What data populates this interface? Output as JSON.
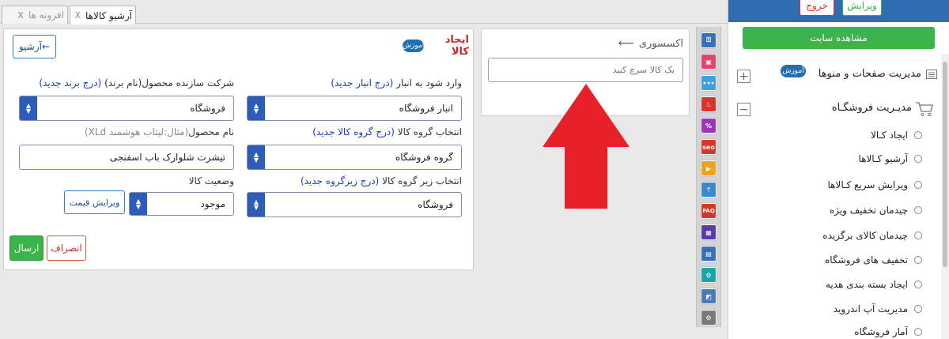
{
  "tabs": [
    {
      "label": "آرشیو کالاها",
      "close": "X",
      "active": true
    },
    {
      "label": "افزونه ها",
      "close": "X",
      "active": false
    }
  ],
  "form": {
    "title": "ایجاد کالا",
    "tutorial_badge": "آموزش",
    "archive_button": "آرشیو←",
    "warehouse_label": "وارد شود به انبار",
    "warehouse_link": "(درج انبار جدید)",
    "warehouse_value": "انبار فروشگاه",
    "manufacturer_label": "شرکت سازنده محصول(نام برند)",
    "manufacturer_link": "(درج برند جدید)",
    "manufacturer_value": "فروشگاه",
    "group_label": "انتخاب گروه کالا",
    "group_link": "(درج گروه کالا جدید)",
    "group_value": "گروه فروشگاه",
    "product_name_label": "نام محصول",
    "product_name_hint": "(مثال:لپتاب هوشمند XLd)",
    "product_name_value": "تیشرت شلوارک باب اسفنجی",
    "subgroup_label": "انتخاب زیر گروه کالا",
    "subgroup_link": "(درج زیرگروه جدید)",
    "subgroup_value": "فروشگاه",
    "status_label": "وضعیت کالا",
    "status_value": "موجود",
    "edit_price_button": "ویرایش قیمت",
    "cancel_button": "انصراف",
    "submit_button": "ارسال"
  },
  "accessory": {
    "title": "اکسسوری",
    "arrow": "⟵",
    "search_placeholder": "یک کالا سرچ کنید"
  },
  "icons": [
    {
      "name": "seo-icon",
      "text": "seo",
      "color": "#d9342b"
    },
    {
      "name": "faq-icon",
      "text": "FAQ",
      "color": "#d9342b"
    }
  ],
  "sidebar": {
    "edit_button": "ویرایش",
    "logout_button": "خروج",
    "view_site_button": "مشاهده سایت",
    "pages_menu_title": "مدیریت صفحات و منوها",
    "tutorial_badge": "آموزش",
    "shop_menu_title": "مدیـریت فروشگـاه",
    "expand_symbol": "+",
    "collapse_symbol": "−",
    "items": [
      {
        "label": "ایجاد کـالا"
      },
      {
        "label": "آرشیو کـالاها"
      },
      {
        "label": "ویرایش سریع کـالاها"
      },
      {
        "label": "چیدمان تخفیف ویژه"
      },
      {
        "label": "چیدمان کالای برگزیده"
      },
      {
        "label": "تخفیف های فروشگاه"
      },
      {
        "label": "ایجاد بسته بندی هدیه"
      },
      {
        "label": "مدیریت آپ اندروید"
      },
      {
        "label": "آمار فروشگاه"
      }
    ]
  },
  "colors": {
    "arrow_red": "#e8202a",
    "primary_blue": "#2d5db8",
    "green": "#3cb44b"
  }
}
